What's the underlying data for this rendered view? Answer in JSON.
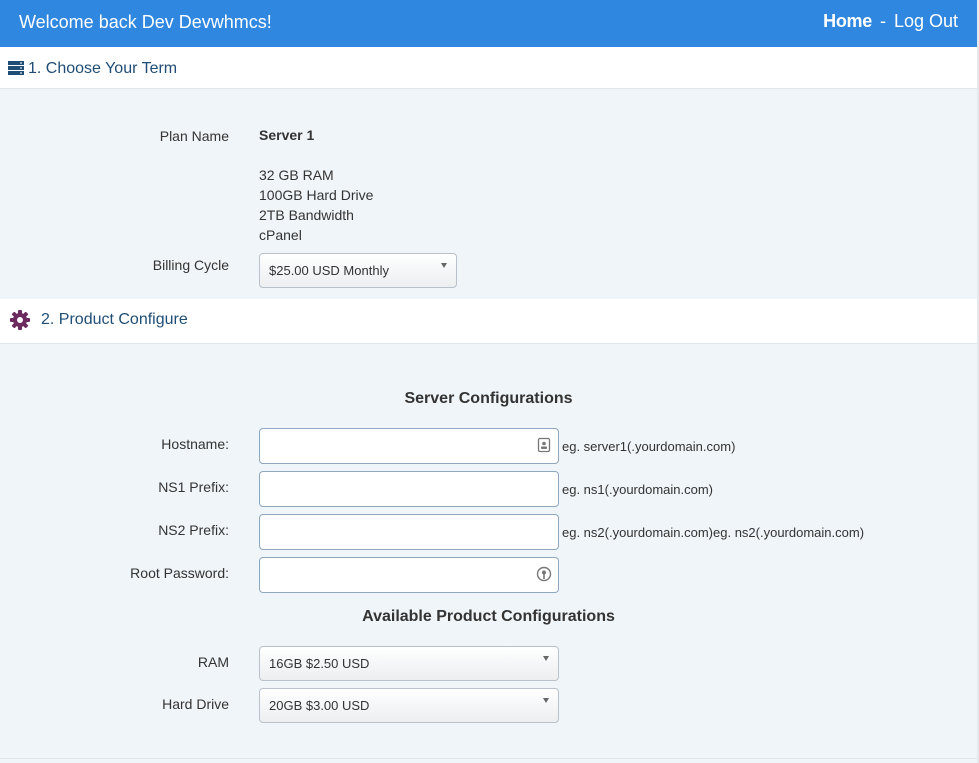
{
  "header": {
    "welcome": "Welcome back Dev Devwhmcs!",
    "home": "Home",
    "separator": "-",
    "logout": "Log Out"
  },
  "term": {
    "title": "1. Choose Your Term",
    "plan_name_label": "Plan Name",
    "plan_name": "Server 1",
    "features": [
      "32 GB RAM",
      "100GB Hard Drive",
      "2TB Bandwidth",
      "cPanel"
    ],
    "billing_cycle_label": "Billing Cycle",
    "billing_cycle_value": "$25.00 USD Monthly"
  },
  "configure": {
    "title": "2. Product Configure",
    "server_config_heading": "Server Configurations",
    "hostname_label": "Hostname:",
    "hostname_value": "",
    "hostname_hint": "eg. server1(.yourdomain.com)",
    "ns1_label": "NS1 Prefix:",
    "ns1_value": "",
    "ns1_hint": "eg. ns1(.yourdomain.com)",
    "ns2_label": "NS2 Prefix:",
    "ns2_value": "",
    "ns2_hint": "eg. ns2(.yourdomain.com)eg. ns2(.yourdomain.com)",
    "root_password_label": "Root Password:",
    "root_password_value": "",
    "available_heading": "Available Product Configurations",
    "ram_label": "RAM",
    "ram_value": "16GB $2.50 USD",
    "hdd_label": "Hard Drive",
    "hdd_value": "20GB $3.00 USD"
  },
  "icons": {
    "term": "server-icon",
    "configure": "gear-icon",
    "hostname_field": "contact-card-icon",
    "password_field": "key-icon"
  },
  "colors": {
    "topbar": "#2f87e0",
    "section_title": "#1f4d75",
    "gear": "#6b2b5e",
    "page_bg": "#f0f5f9"
  }
}
